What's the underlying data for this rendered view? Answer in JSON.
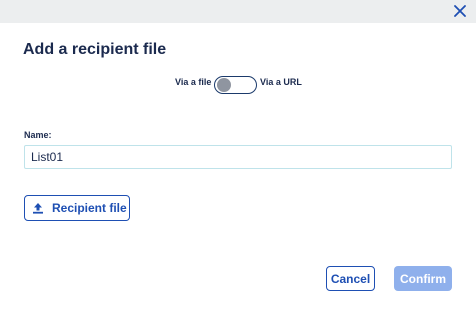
{
  "dialog": {
    "title": "Add a recipient file",
    "close_icon": "close-icon"
  },
  "source_toggle": {
    "left_label": "Via a file",
    "right_label": "Via a URL",
    "state": "off"
  },
  "name_field": {
    "label": "Name:",
    "value": "List01"
  },
  "upload_button": {
    "label": "Recipient file",
    "icon": "upload-icon"
  },
  "footer": {
    "cancel_label": "Cancel",
    "confirm_label": "Confirm",
    "confirm_enabled": false
  },
  "colors": {
    "primary": "#1e4fb3",
    "text": "#1b2a4e",
    "confirm_disabled": "#8fb0ec",
    "input_border": "#bfe3ea"
  }
}
